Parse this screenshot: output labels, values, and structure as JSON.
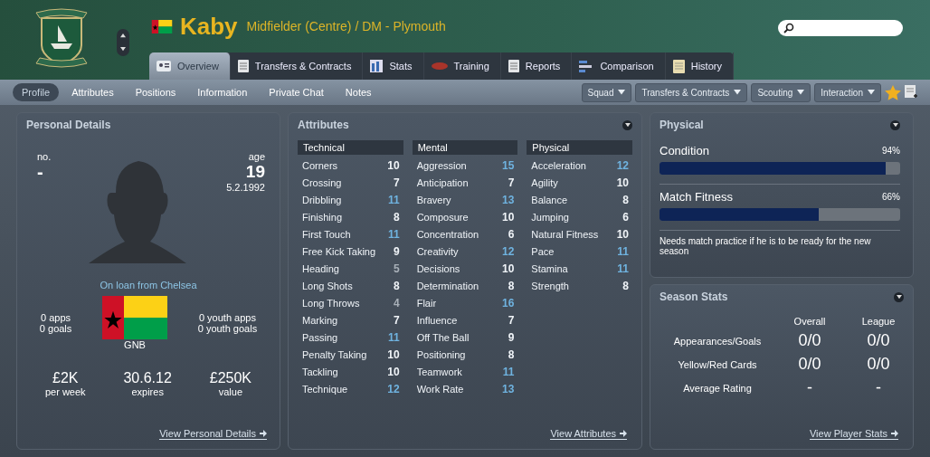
{
  "header": {
    "name": "Kaby",
    "subtitle": "Midfielder (Centre) / DM - Plymouth"
  },
  "tabs": [
    {
      "label": "Overview",
      "selected": true
    },
    {
      "label": "Transfers & Contracts",
      "selected": false
    },
    {
      "label": "Stats",
      "selected": false
    },
    {
      "label": "Training",
      "selected": false
    },
    {
      "label": "Reports",
      "selected": false
    },
    {
      "label": "Comparison",
      "selected": false
    },
    {
      "label": "History",
      "selected": false
    }
  ],
  "subnav": [
    {
      "label": "Profile",
      "selected": true
    },
    {
      "label": "Attributes",
      "selected": false
    },
    {
      "label": "Positions",
      "selected": false
    },
    {
      "label": "Information",
      "selected": false
    },
    {
      "label": "Private Chat",
      "selected": false
    },
    {
      "label": "Notes",
      "selected": false
    }
  ],
  "menus": [
    "Squad",
    "Transfers & Contracts",
    "Scouting",
    "Interaction"
  ],
  "personal": {
    "title": "Personal Details",
    "no_label": "no.",
    "no_value": "-",
    "age_label": "age",
    "age_value": "19",
    "dob": "5.2.1992",
    "loan": "On loan from Chelsea",
    "apps": "0 apps",
    "goals": "0 goals",
    "youth_apps": "0 youth apps",
    "youth_goals": "0 youth goals",
    "nation": "GNB",
    "stats": [
      {
        "value": "£2K",
        "label": "per week"
      },
      {
        "value": "30.6.12",
        "label": "expires"
      },
      {
        "value": "£250K",
        "label": "value"
      }
    ],
    "link": "View Personal Details"
  },
  "attributes": {
    "title": "Attributes",
    "link": "View Attributes",
    "groups": [
      {
        "name": "Technical",
        "items": [
          {
            "name": "Corners",
            "value": "10",
            "color": "#f0f4f8"
          },
          {
            "name": "Crossing",
            "value": "7",
            "color": "#f0f4f8"
          },
          {
            "name": "Dribbling",
            "value": "11",
            "color": "#6fb3e0"
          },
          {
            "name": "Finishing",
            "value": "8",
            "color": "#f0f4f8"
          },
          {
            "name": "First Touch",
            "value": "11",
            "color": "#6fb3e0"
          },
          {
            "name": "Free Kick Taking",
            "value": "9",
            "color": "#f0f4f8"
          },
          {
            "name": "Heading",
            "value": "5",
            "color": "#a8b0b8"
          },
          {
            "name": "Long Shots",
            "value": "8",
            "color": "#f0f4f8"
          },
          {
            "name": "Long Throws",
            "value": "4",
            "color": "#a8b0b8"
          },
          {
            "name": "Marking",
            "value": "7",
            "color": "#f0f4f8"
          },
          {
            "name": "Passing",
            "value": "11",
            "color": "#6fb3e0"
          },
          {
            "name": "Penalty Taking",
            "value": "10",
            "color": "#f0f4f8"
          },
          {
            "name": "Tackling",
            "value": "10",
            "color": "#f0f4f8"
          },
          {
            "name": "Technique",
            "value": "12",
            "color": "#6fb3e0"
          }
        ]
      },
      {
        "name": "Mental",
        "items": [
          {
            "name": "Aggression",
            "value": "15",
            "color": "#6fb3e0"
          },
          {
            "name": "Anticipation",
            "value": "7",
            "color": "#f0f4f8"
          },
          {
            "name": "Bravery",
            "value": "13",
            "color": "#6fb3e0"
          },
          {
            "name": "Composure",
            "value": "10",
            "color": "#f0f4f8"
          },
          {
            "name": "Concentration",
            "value": "6",
            "color": "#f0f4f8"
          },
          {
            "name": "Creativity",
            "value": "12",
            "color": "#6fb3e0"
          },
          {
            "name": "Decisions",
            "value": "10",
            "color": "#f0f4f8"
          },
          {
            "name": "Determination",
            "value": "8",
            "color": "#f0f4f8"
          },
          {
            "name": "Flair",
            "value": "16",
            "color": "#6fb3e0"
          },
          {
            "name": "Influence",
            "value": "7",
            "color": "#f0f4f8"
          },
          {
            "name": "Off The Ball",
            "value": "9",
            "color": "#f0f4f8"
          },
          {
            "name": "Positioning",
            "value": "8",
            "color": "#f0f4f8"
          },
          {
            "name": "Teamwork",
            "value": "11",
            "color": "#6fb3e0"
          },
          {
            "name": "Work Rate",
            "value": "13",
            "color": "#6fb3e0"
          }
        ]
      },
      {
        "name": "Physical",
        "items": [
          {
            "name": "Acceleration",
            "value": "12",
            "color": "#6fb3e0"
          },
          {
            "name": "Agility",
            "value": "10",
            "color": "#f0f4f8"
          },
          {
            "name": "Balance",
            "value": "8",
            "color": "#f0f4f8"
          },
          {
            "name": "Jumping",
            "value": "6",
            "color": "#f0f4f8"
          },
          {
            "name": "Natural Fitness",
            "value": "10",
            "color": "#f0f4f8"
          },
          {
            "name": "Pace",
            "value": "11",
            "color": "#6fb3e0"
          },
          {
            "name": "Stamina",
            "value": "11",
            "color": "#6fb3e0"
          },
          {
            "name": "Strength",
            "value": "8",
            "color": "#f0f4f8"
          }
        ]
      }
    ]
  },
  "physical": {
    "title": "Physical",
    "meters": [
      {
        "name": "Condition",
        "reading": "94%",
        "level": 0.94
      },
      {
        "name": "Match Fitness",
        "reading": "66%",
        "level": 0.66
      }
    ],
    "note": "Needs match practice if he is to be ready for the new season"
  },
  "season": {
    "title": "Season Stats",
    "columns": [
      "Overall",
      "League"
    ],
    "rows": [
      {
        "label": "Appearances/Goals",
        "values": [
          "0/0",
          "0/0"
        ]
      },
      {
        "label": "Yellow/Red Cards",
        "values": [
          "0/0",
          "0/0"
        ]
      },
      {
        "label": "Average Rating",
        "values": [
          "-",
          "-"
        ]
      }
    ],
    "link": "View Player Stats"
  }
}
